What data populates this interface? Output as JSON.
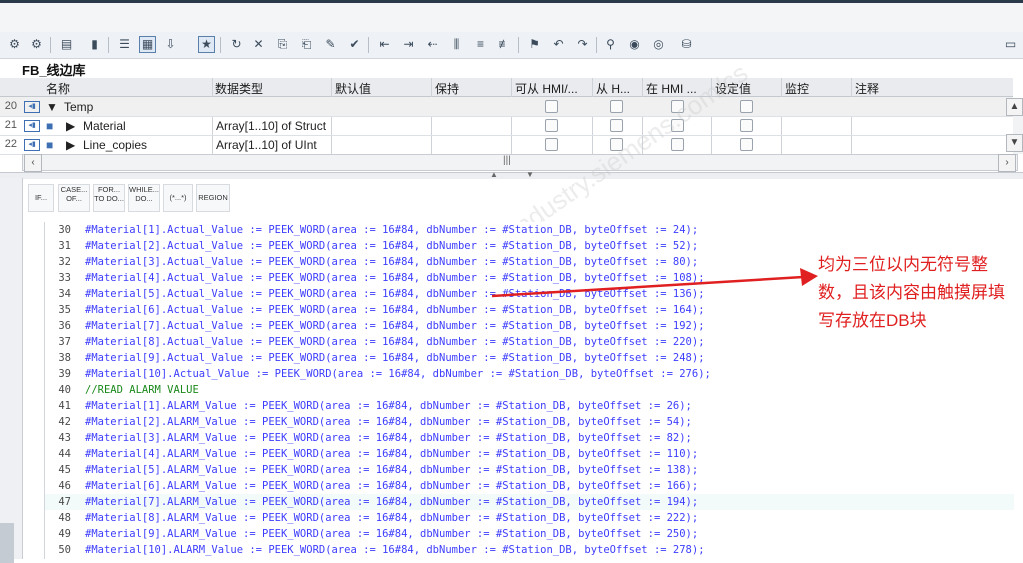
{
  "block_name": "FB_线边库",
  "table": {
    "headers": [
      "名称",
      "数据类型",
      "默认值",
      "保持",
      "可从 HMI/...",
      "从 H...",
      "在 HMI ...",
      "设定值",
      "监控",
      "注释"
    ],
    "rows": [
      {
        "num": "20",
        "name": "Temp",
        "type": ""
      },
      {
        "num": "21",
        "name": "Material",
        "type": "Array[1..10] of Struct"
      },
      {
        "num": "22",
        "name": "Line_copies",
        "type": "Array[1..10] of UInt"
      }
    ]
  },
  "scroll_center": "|||",
  "code_buttons": [
    "IF...",
    "CASE... OF...",
    "FOR... TO DO...",
    "WHILE... DO...",
    "(*...*)",
    "REGION"
  ],
  "code": [
    {
      "n": "30",
      "t": "#Material[1].Actual_Value := PEEK_WORD(area := 16#84, dbNumber := #Station_DB, byteOffset := 24);"
    },
    {
      "n": "31",
      "t": "#Material[2].Actual_Value := PEEK_WORD(area := 16#84, dbNumber := #Station_DB, byteOffset := 52);"
    },
    {
      "n": "32",
      "t": "#Material[3].Actual_Value := PEEK_WORD(area := 16#84, dbNumber := #Station_DB, byteOffset := 80);"
    },
    {
      "n": "33",
      "t": "#Material[4].Actual_Value := PEEK_WORD(area := 16#84, dbNumber := #Station_DB, byteOffset := 108);"
    },
    {
      "n": "34",
      "t": "#Material[5].Actual_Value := PEEK_WORD(area := 16#84, dbNumber := #Station_DB, byteOffset := 136);"
    },
    {
      "n": "35",
      "t": "#Material[6].Actual_Value := PEEK_WORD(area := 16#84, dbNumber := #Station_DB, byteOffset := 164);"
    },
    {
      "n": "36",
      "t": "#Material[7].Actual_Value := PEEK_WORD(area := 16#84, dbNumber := #Station_DB, byteOffset := 192);"
    },
    {
      "n": "37",
      "t": "#Material[8].Actual_Value := PEEK_WORD(area := 16#84, dbNumber := #Station_DB, byteOffset := 220);"
    },
    {
      "n": "38",
      "t": "#Material[9].Actual_Value := PEEK_WORD(area := 16#84, dbNumber := #Station_DB, byteOffset := 248);"
    },
    {
      "n": "39",
      "t": "#Material[10].Actual_Value := PEEK_WORD(area := 16#84, dbNumber := #Station_DB, byteOffset := 276);"
    },
    {
      "n": "40",
      "t": "//READ ALARM VALUE",
      "comment": true
    },
    {
      "n": "41",
      "t": "#Material[1].ALARM_Value := PEEK_WORD(area := 16#84, dbNumber := #Station_DB, byteOffset := 26);"
    },
    {
      "n": "42",
      "t": "#Material[2].ALARM_Value := PEEK_WORD(area := 16#84, dbNumber := #Station_DB, byteOffset := 54);"
    },
    {
      "n": "43",
      "t": "#Material[3].ALARM_Value := PEEK_WORD(area := 16#84, dbNumber := #Station_DB, byteOffset := 82);"
    },
    {
      "n": "44",
      "t": "#Material[4].ALARM_Value := PEEK_WORD(area := 16#84, dbNumber := #Station_DB, byteOffset := 110);"
    },
    {
      "n": "45",
      "t": "#Material[5].ALARM_Value := PEEK_WORD(area := 16#84, dbNumber := #Station_DB, byteOffset := 138);"
    },
    {
      "n": "46",
      "t": "#Material[6].ALARM_Value := PEEK_WORD(area := 16#84, dbNumber := #Station_DB, byteOffset := 166);"
    },
    {
      "n": "47",
      "t": "#Material[7].ALARM_Value := PEEK_WORD(area := 16#84, dbNumber := #Station_DB, byteOffset := 194);"
    },
    {
      "n": "48",
      "t": "#Material[8].ALARM_Value := PEEK_WORD(area := 16#84, dbNumber := #Station_DB, byteOffset := 222);"
    },
    {
      "n": "49",
      "t": "#Material[9].ALARM_Value := PEEK_WORD(area := 16#84, dbNumber := #Station_DB, byteOffset := 250);"
    },
    {
      "n": "50",
      "t": "#Material[10].ALARM_Value := PEEK_WORD(area := 16#84, dbNumber := #Station_DB, byteOffset := 278);"
    }
  ],
  "annotation": "均为三位以内无符号整数，且该内容由触摸屏填写存放在DB块",
  "colors": {
    "annotation_red": "#e02020",
    "code_blue": "#3d3dff",
    "comment_green": "#1a8a1a"
  }
}
